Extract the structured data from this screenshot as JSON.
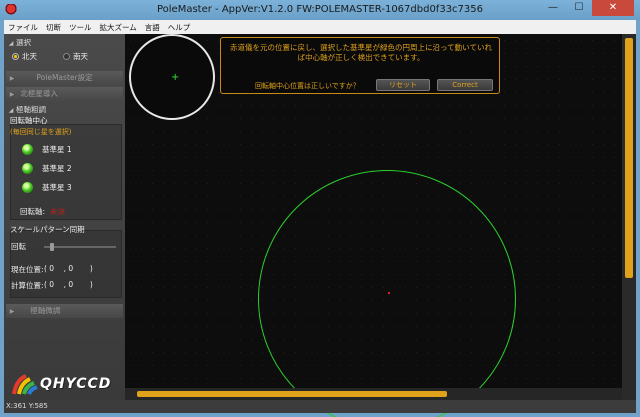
{
  "window": {
    "title": "PoleMaster - AppVer:V1.2.0 FW:POLEMASTER-1067dbd0f33c7356",
    "minimize": "—",
    "maximize": "☐",
    "close": "✕"
  },
  "menu": [
    "ファイル",
    "切断",
    "ツール",
    "拡大ズーム",
    "言語",
    "ヘルプ"
  ],
  "sidebar": {
    "select_header": "選択",
    "north_label": "北天",
    "south_label": "南天",
    "hemisphere_selected": "北天",
    "polemaster_settings": "PoleMaster設定",
    "polar_align_intro": "北極星導入",
    "rough_adjust": "極軸粗調",
    "rotation_center": "回転軸中心",
    "hint": "(毎回同じ星を選択)",
    "stars": [
      "基準星 1",
      "基準星 2",
      "基準星 3"
    ],
    "axis_label": "回転軸:",
    "axis_value": "未決",
    "scale_pattern": "スケールパターン同期",
    "rotation_label": "回転",
    "current_pos_label": "現在位置:",
    "current_pos_value": "( 0    , 0       )",
    "calc_pos_label": "計算位置:",
    "calc_pos_value": "( 0    , 0       )",
    "fine_adjust": "極軸微調",
    "logo": "QHYCCD"
  },
  "viewer": {
    "notice_text": "赤道儀を元の位置に戻し、選択した基準星が緑色の円周上に沿って動いていれば中心軸が正しく検出できています。",
    "question": "回転軸中心位置は正しいですか？",
    "reset_button": "リセット",
    "correct_button": "Correct",
    "crosshair": "+"
  },
  "status": {
    "coords": "X:361 Y:585"
  },
  "colors": {
    "accent": "#e0a21b",
    "circle": "#2ccf2c",
    "center": "#d22222",
    "titlebar": "#6fa3c9"
  }
}
